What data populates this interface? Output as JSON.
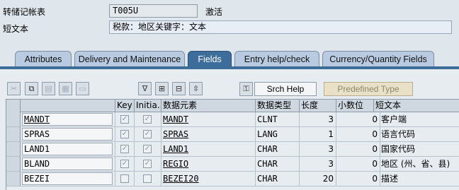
{
  "header": {
    "table_label": "转储记帐表",
    "table_value": "T005U",
    "status": "激活",
    "short_text_label": "短文本",
    "short_text_value": "税款：地区关键字：文本"
  },
  "tabs": [
    {
      "label": "Attributes"
    },
    {
      "label": "Delivery and Maintenance"
    },
    {
      "label": "Fields"
    },
    {
      "label": "Entry help/check"
    },
    {
      "label": "Currency/Quantity Fields"
    }
  ],
  "toolbar": {
    "srch_help_label": "Srch Help",
    "predefined_type_label": "Predefined Type"
  },
  "table": {
    "columns": [
      "Key",
      "Initia...",
      "数据元素",
      "数据类型",
      "长度",
      "小数位",
      "短文本"
    ],
    "rows": [
      {
        "field": "MANDT",
        "key": true,
        "init": true,
        "element": "MANDT",
        "type": "CLNT",
        "length": "3",
        "decimals": "0",
        "text": "客户端"
      },
      {
        "field": "SPRAS",
        "key": true,
        "init": true,
        "element": "SPRAS",
        "type": "LANG",
        "length": "1",
        "decimals": "0",
        "text": "语言代码"
      },
      {
        "field": "LAND1",
        "key": true,
        "init": true,
        "element": "LAND1",
        "type": "CHAR",
        "length": "3",
        "decimals": "0",
        "text": "国家代码"
      },
      {
        "field": "BLAND",
        "key": true,
        "init": true,
        "element": "REGIO",
        "type": "CHAR",
        "length": "3",
        "decimals": "0",
        "text": "地区 (州、省、县)"
      },
      {
        "field": "BEZEI",
        "key": false,
        "init": false,
        "element": "BEZEI20",
        "type": "CHAR",
        "length": "20",
        "decimals": "0",
        "text": "描述"
      }
    ]
  },
  "colors": {
    "active_tab": "#3d6d9a",
    "tab": "#b9cbe0",
    "background": "#dfe6ec"
  }
}
